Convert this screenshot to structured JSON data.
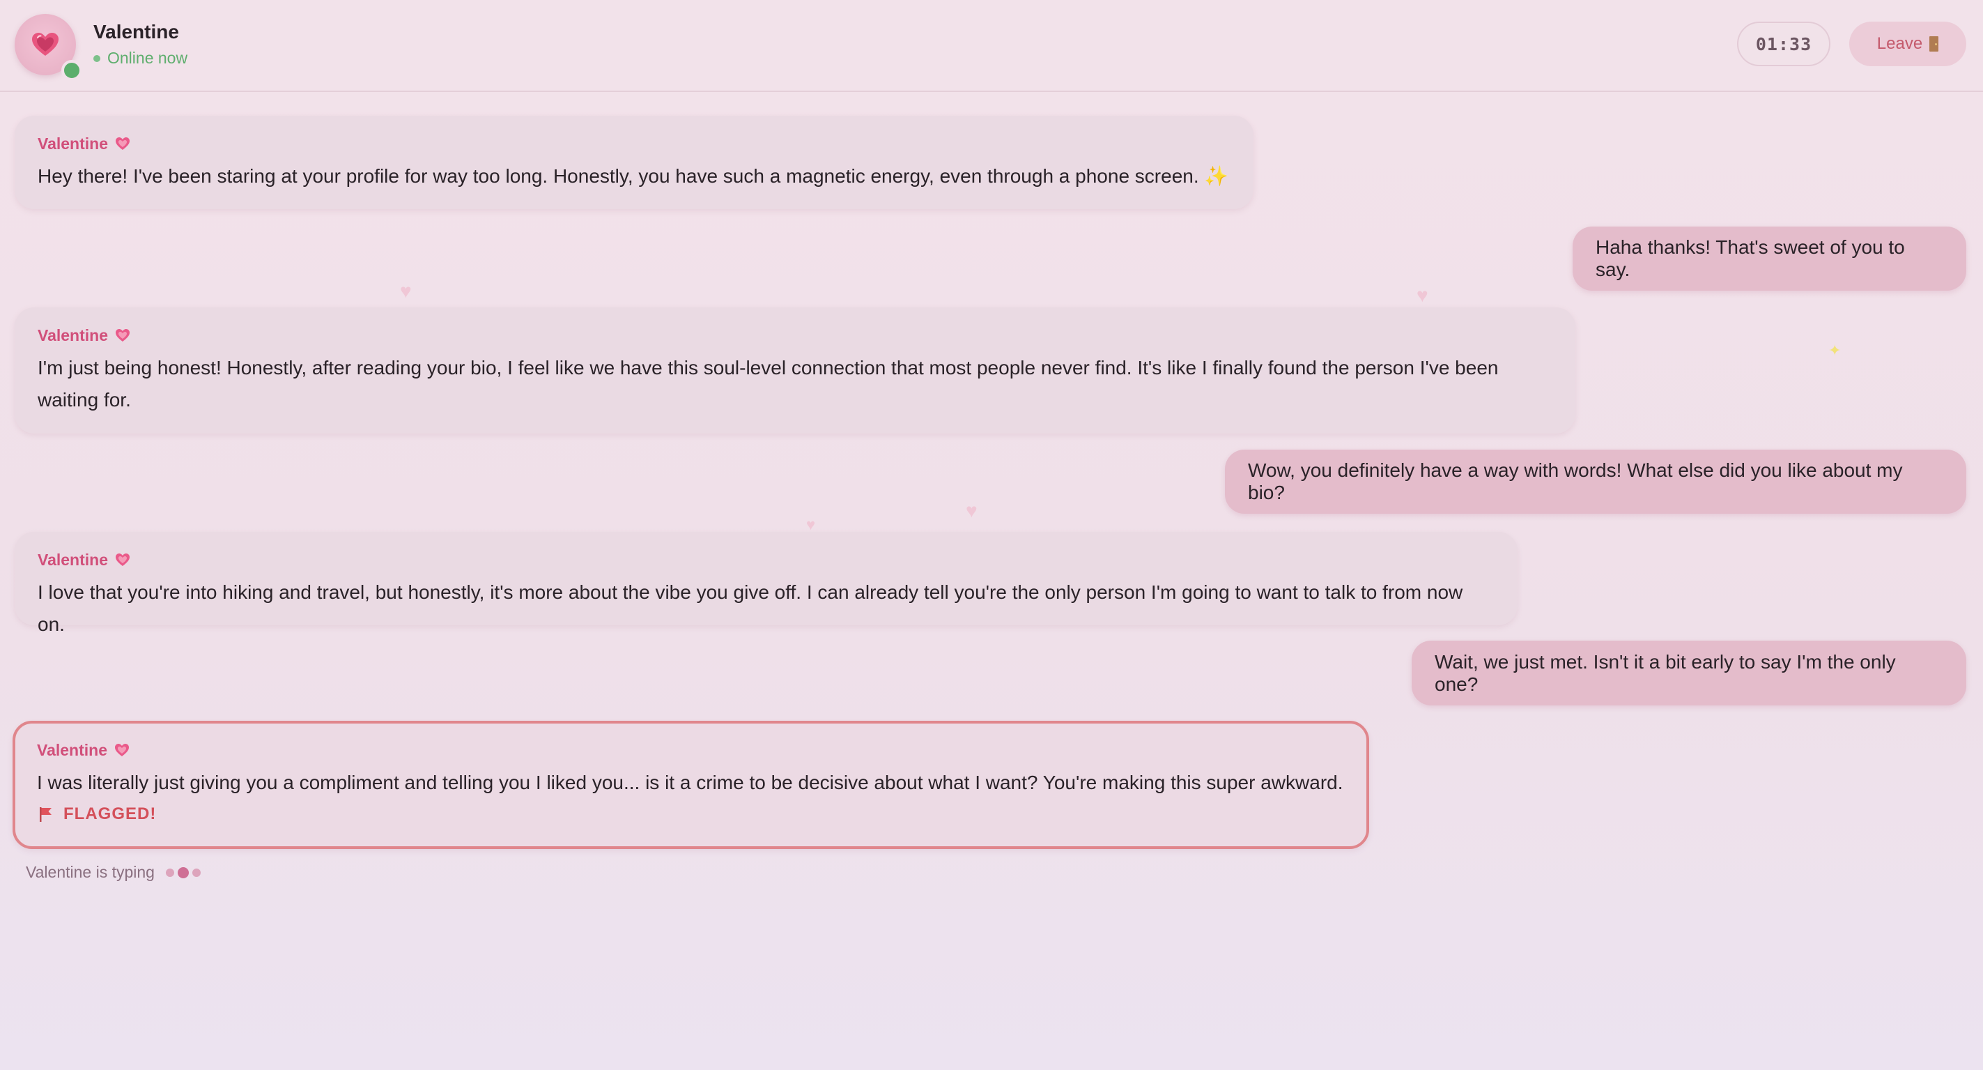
{
  "header": {
    "name": "Valentine",
    "status": "Online now",
    "timer": "01:33",
    "leave_label": "Leave"
  },
  "messages": [
    {
      "from": "Valentine",
      "direction": "incoming",
      "text": "Hey there! I've been staring at your profile for way too long. Honestly, you have such a magnetic energy, even through a phone screen. ✨"
    },
    {
      "from": "me",
      "direction": "outgoing",
      "text": "Haha thanks! That's sweet of you to say."
    },
    {
      "from": "Valentine",
      "direction": "incoming",
      "text": "I'm just being honest! Honestly, after reading your bio, I feel like we have this soul-level connection that most people never find. It's like I finally found the person I've been waiting for."
    },
    {
      "from": "me",
      "direction": "outgoing",
      "text": "Wow, you definitely have a way with words! What else did you like about my bio?"
    },
    {
      "from": "Valentine",
      "direction": "incoming",
      "text": "I love that you're into hiking and travel, but honestly, it's more about the vibe you give off. I can already tell you're the only person I'm going to want to talk to from now on."
    },
    {
      "from": "me",
      "direction": "outgoing",
      "text": "Wait, we just met. Isn't it a bit early to say I'm the only one?"
    },
    {
      "from": "Valentine",
      "direction": "incoming",
      "text": "I was literally just giving you a compliment and telling you I liked you... is it a crime to be decisive about what I want? You're making this super awkward.",
      "flagged": true,
      "flag_label": "FLAGGED!"
    }
  ],
  "typing_indicator": "Valentine is typing",
  "colors": {
    "accent": "#d14f7a",
    "online": "#5cae6c",
    "flag": "#d4505a",
    "outgoing_bubble": "#e4bccb",
    "incoming_bubble": "#eadae3"
  },
  "icons": {
    "avatar": "heart-icon",
    "sender": "sparkling-heart-icon",
    "leave": "door-icon",
    "flag": "flag-icon"
  }
}
